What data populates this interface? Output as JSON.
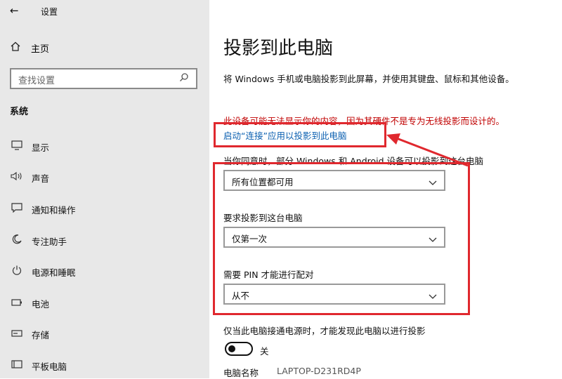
{
  "window": {
    "title": "设置"
  },
  "sidebar": {
    "home_label": "主页",
    "search_placeholder": "查找设置",
    "section_title": "系统",
    "items": [
      {
        "label": "显示",
        "icon": "monitor-icon"
      },
      {
        "label": "声音",
        "icon": "speaker-icon"
      },
      {
        "label": "通知和操作",
        "icon": "notification-icon"
      },
      {
        "label": "专注助手",
        "icon": "moon-icon"
      },
      {
        "label": "电源和睡眠",
        "icon": "power-icon"
      },
      {
        "label": "电池",
        "icon": "battery-icon"
      },
      {
        "label": "存储",
        "icon": "storage-icon"
      },
      {
        "label": "平板电脑",
        "icon": "tablet-icon"
      }
    ]
  },
  "main": {
    "title": "投影到此电脑",
    "description": "将 Windows 手机或电脑投影到此屏幕，并使用其键盘、鼠标和其他设备。",
    "warning": "此设备可能无法显示你的内容，因为其硬件不是专为无线投影而设计的。",
    "link": "启动“连接”应用以投影到此电脑",
    "intro": "当你同意时，部分 Windows 和 Android 设备可以投影到这台电脑",
    "availability": {
      "selected": "所有位置都可用"
    },
    "require_projection": {
      "label": "要求投影到这台电脑",
      "selected": "仅第一次"
    },
    "require_pin": {
      "label": "需要 PIN 才能进行配对",
      "selected": "从不"
    },
    "discover": {
      "label": "仅当此电脑接通电源时，才能发现此电脑以进行投影",
      "state": "关"
    },
    "pc_name": {
      "label": "电脑名称",
      "value": "LAPTOP-D231RD4P"
    }
  },
  "colors": {
    "sidebar_bg": "#e8e8e8",
    "warning": "#c00000",
    "link": "#0a5fb0",
    "annotation": "#e0282e"
  }
}
